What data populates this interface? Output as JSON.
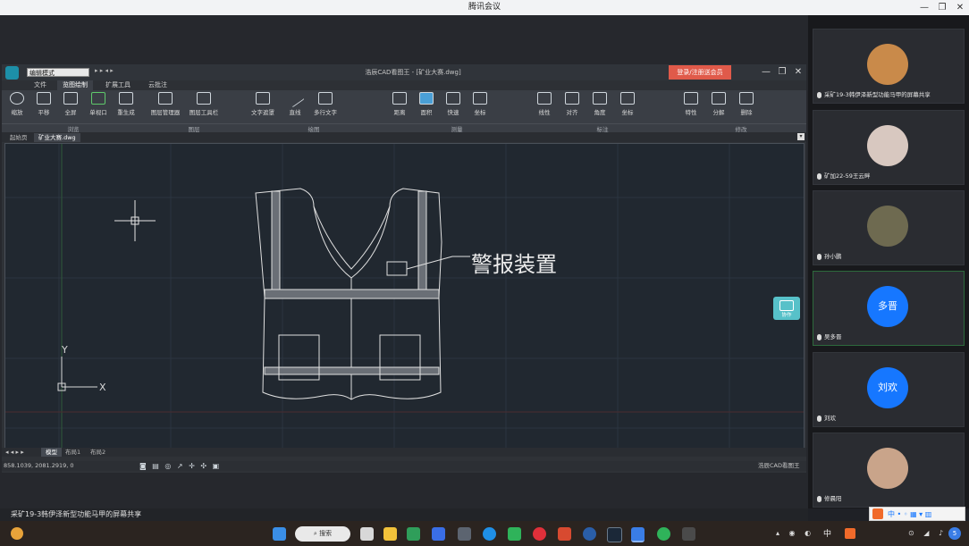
{
  "meeting": {
    "title": "腾讯会议",
    "share_caption": "采矿19-3韩伊泽新型功能马甲的屏幕共享"
  },
  "cad": {
    "mode_select": "编辑模式",
    "title": "浩辰CAD看图王 - [矿业大赛.dwg]",
    "login_button": "登录/注册送会员",
    "menu_tabs": [
      "文件",
      "览图绘制",
      "扩展工具",
      "云批注"
    ],
    "ribbon_items": [
      "缩放",
      "平移",
      "全屏",
      "单视口",
      "重生成",
      "图层管理器",
      "图层工具栏",
      "文字遮罩",
      "直线",
      "多行文字",
      "距离",
      "面积",
      "快速",
      "坐标",
      "线性",
      "对齐",
      "角度",
      "坐标",
      "特性",
      "分解",
      "删除"
    ],
    "ribbon_groups": [
      "浏览",
      "图层",
      "绘图",
      "测量",
      "标注",
      "修改"
    ],
    "doc_tabs": [
      "起始页",
      "矿业大赛.dwg"
    ],
    "drawing_annotation": "警报装置",
    "axis_y": "Y",
    "axis_x": "X",
    "layout_tabs": [
      "模型",
      "布局1",
      "布局2"
    ],
    "coords": "858.1039, 2081.2919, 0",
    "status_brand": "浩辰CAD看图王",
    "chat_widget_label": "协作"
  },
  "participants": [
    {
      "name": "采矿19-3韩伊泽新型功能马甲的屏幕共享",
      "avatar_type": "photo",
      "avatar_color": "#c98a4a"
    },
    {
      "name": "矿加22-59王云畔",
      "avatar_type": "photo",
      "avatar_color": "#d8c8c0"
    },
    {
      "name": "孙小鹏",
      "avatar_type": "photo",
      "avatar_color": "#6e6a50"
    },
    {
      "name": "吴多晋",
      "avatar_type": "initials",
      "initials": "多晋",
      "avatar_color": "#1677ff"
    },
    {
      "name": "刘欢",
      "avatar_type": "initials",
      "initials": "刘欢",
      "avatar_color": "#1677ff"
    },
    {
      "name": "修晨阳",
      "avatar_type": "photo",
      "avatar_color": "#c9a48a"
    }
  ],
  "taskbar": {
    "search_label": "搜索",
    "tray_ime": "中",
    "notification_count": "5"
  },
  "colors": {
    "login_button": "#e05a4a",
    "avatar_blue": "#1677ff",
    "canvas_bg": "#212830",
    "speaking_border": "#2d6a3c"
  }
}
